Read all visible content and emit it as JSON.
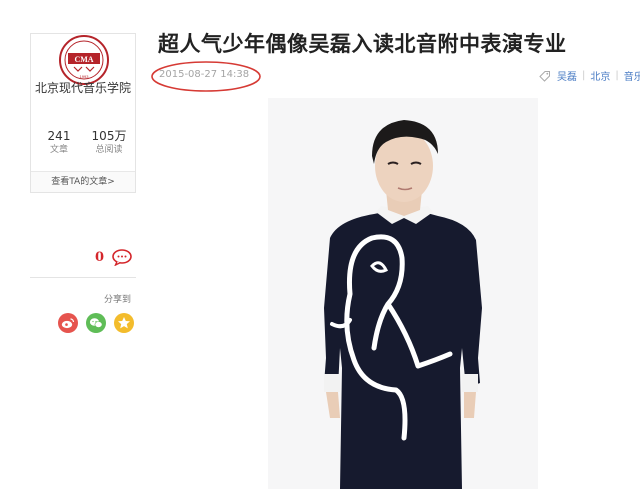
{
  "author": {
    "name": "北京现代音乐学院",
    "logo_text": "CMA",
    "logo_year": "1993",
    "stats": [
      {
        "value": "241",
        "label": "文章"
      },
      {
        "value": "105万",
        "label": "总阅读"
      }
    ],
    "view_articles_label": "查看TA的文章>"
  },
  "comments": {
    "count": "0"
  },
  "share": {
    "label": "分享到",
    "icons": [
      "weibo-icon",
      "wechat-icon",
      "qzone-icon"
    ]
  },
  "article": {
    "title": "超人气少年偶像吴磊入读北音附中表演专业",
    "datetime": "2015-08-27 14:38",
    "tags": [
      "吴磊",
      "北京",
      "音乐"
    ]
  },
  "colors": {
    "accent_red": "#d4262b",
    "tag_blue": "#4a7cc4",
    "weibo": "#e6544e",
    "wechat": "#5fbd57",
    "qzone": "#f3bc2c"
  }
}
